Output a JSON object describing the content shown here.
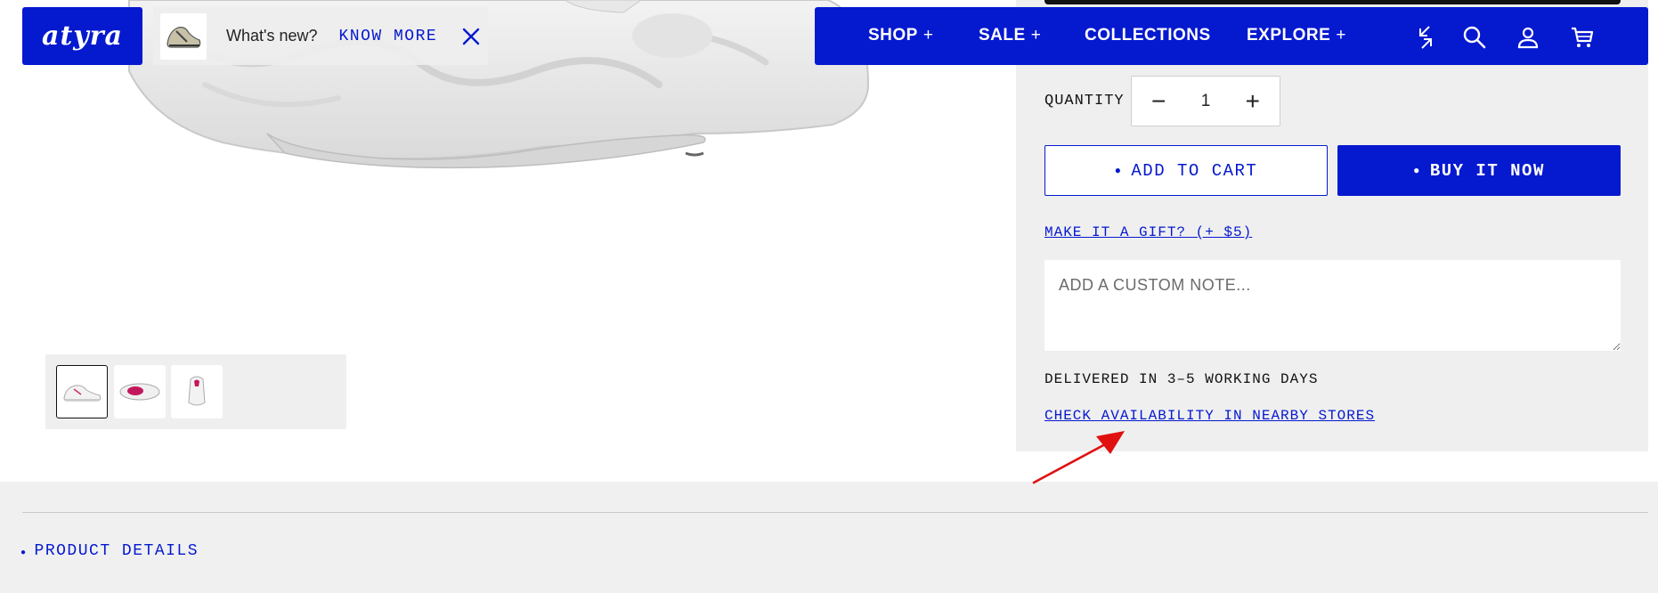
{
  "brand": {
    "logo_text": "atyra"
  },
  "announcement": {
    "text": "What's new?",
    "link_label": "KNOW MORE",
    "close_icon": "close-icon"
  },
  "nav": {
    "items": [
      {
        "label": "SHOP",
        "suffix": "+"
      },
      {
        "label": "SALE",
        "suffix": "+"
      },
      {
        "label": "COLLECTIONS",
        "suffix": ""
      },
      {
        "label": "EXPLORE",
        "suffix": "+"
      }
    ],
    "icons": [
      "compare-icon",
      "search-icon",
      "account-icon",
      "cart-icon"
    ]
  },
  "purchase": {
    "quantity_label": "QUANTITY",
    "quantity_value": "1",
    "decrement": "−",
    "increment": "+",
    "add_to_cart": "ADD TO CART",
    "buy_now": "BUY IT NOW",
    "gift_link": "MAKE IT A GIFT? (+ $5)",
    "note_placeholder": "ADD A CUSTOM NOTE...",
    "delivery_text": "DELIVERED IN 3–5 WORKING DAYS",
    "availability_link": "CHECK AVAILABILITY IN NEARBY STORES"
  },
  "gallery": {
    "thumbnails": [
      "shoe-side-view",
      "shoe-top-view",
      "shoe-back-view"
    ],
    "active_index": 0
  },
  "sections": {
    "product_details": "PRODUCT DETAILS"
  },
  "colors": {
    "accent": "#0519cf",
    "panel_bg": "#efefef",
    "annotation_arrow": "#e01010"
  }
}
